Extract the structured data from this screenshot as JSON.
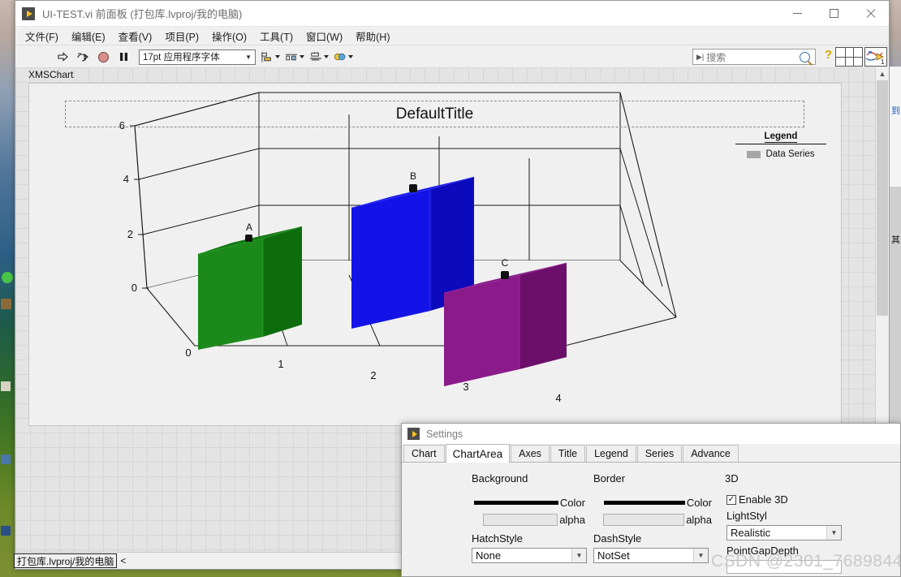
{
  "window": {
    "title": "UI-TEST.vi 前面板 (打包库.lvproj/我的电脑)",
    "app_icon": "labview-run-icon",
    "minimize": "minimize-icon",
    "maximize": "maximize-icon",
    "close": "close-icon"
  },
  "menubar": {
    "items": [
      {
        "label": "文件(F)"
      },
      {
        "label": "编辑(E)"
      },
      {
        "label": "查看(V)"
      },
      {
        "label": "项目(P)"
      },
      {
        "label": "操作(O)"
      },
      {
        "label": "工具(T)"
      },
      {
        "label": "窗口(W)"
      },
      {
        "label": "帮助(H)"
      }
    ]
  },
  "toolbar": {
    "run": "run-arrow-icon",
    "run_continuously": "run-continuously-icon",
    "abort": "abort-execution-icon",
    "pause": "pause-icon",
    "font_value": "17pt 应用程序字体",
    "align_objects": "align-objects-icon",
    "distribute_objects": "distribute-objects-icon",
    "resize_objects": "resize-objects-icon",
    "reorder": "reorder-objects-icon",
    "search_placeholder": "搜索",
    "search_value": "",
    "search_icon": "magnifier-icon",
    "help_icon": "context-help-icon",
    "grid_icon": "window-grid-icon",
    "vi_icon": "vi-connector-icon",
    "vi_icon_number": "1"
  },
  "panel": {
    "label": "XMSChart",
    "scroll_up": "chevron-up-icon"
  },
  "chart": {
    "title": "DefaultTitle",
    "legend_title": "Legend",
    "legend_entries": [
      {
        "label": "Data Series",
        "color": "#a6a6a6"
      }
    ]
  },
  "chart_data": {
    "type": "bar",
    "title": "DefaultTitle",
    "render": "3d-column",
    "categories": [
      "A",
      "B",
      "C"
    ],
    "values": [
      3,
      4,
      2
    ],
    "point_labels": [
      "A",
      "B",
      "C"
    ],
    "colors": [
      "#1a8a1a",
      "#1414e6",
      "#8b1a8b"
    ],
    "series": [
      {
        "name": "Data Series",
        "values": [
          3,
          4,
          2
        ]
      }
    ],
    "xlabel": "",
    "ylabel": "",
    "x_ticks": [
      "0",
      "1",
      "2",
      "3",
      "4"
    ],
    "y_ticks": [
      "0",
      "2",
      "4",
      "6"
    ],
    "xlim": [
      0,
      4
    ],
    "ylim": [
      0,
      6
    ],
    "grid": true,
    "legend_position": "top-right",
    "legend_entries": [
      "Data Series"
    ]
  },
  "statusbar": {
    "project": "打包库.lvproj/我的电脑",
    "scroll_left": "<"
  },
  "settings": {
    "title": "Settings",
    "app_icon": "labview-run-icon",
    "tabs": [
      {
        "label": "Chart",
        "active": false
      },
      {
        "label": "ChartArea",
        "active": true
      },
      {
        "label": "Axes",
        "active": false
      },
      {
        "label": "Title",
        "active": false
      },
      {
        "label": "Legend",
        "active": false
      },
      {
        "label": "Series",
        "active": false
      },
      {
        "label": "Advance",
        "active": false
      }
    ],
    "background": {
      "group": "Background",
      "color_label": "Color",
      "color_value": "#000000",
      "alpha_label": "alpha",
      "alpha_value": "",
      "hatchstyle_label": "HatchStyle",
      "hatchstyle_value": "None"
    },
    "border": {
      "group": "Border",
      "color_label": "Color",
      "color_value": "#000000",
      "alpha_label": "alpha",
      "alpha_value": "",
      "dashstyle_label": "DashStyle",
      "dashstyle_value": "NotSet"
    },
    "three_d": {
      "group": "3D",
      "enable_label": "Enable 3D",
      "enable_checked": true,
      "lightstyl_label": "LightStyl",
      "lightstyl_value": "Realistic",
      "pointgapdepth_label": "PointGapDepth",
      "pointgapdepth_value": ""
    }
  },
  "watermark": {
    "text": "CSDN @2301_76898441"
  }
}
